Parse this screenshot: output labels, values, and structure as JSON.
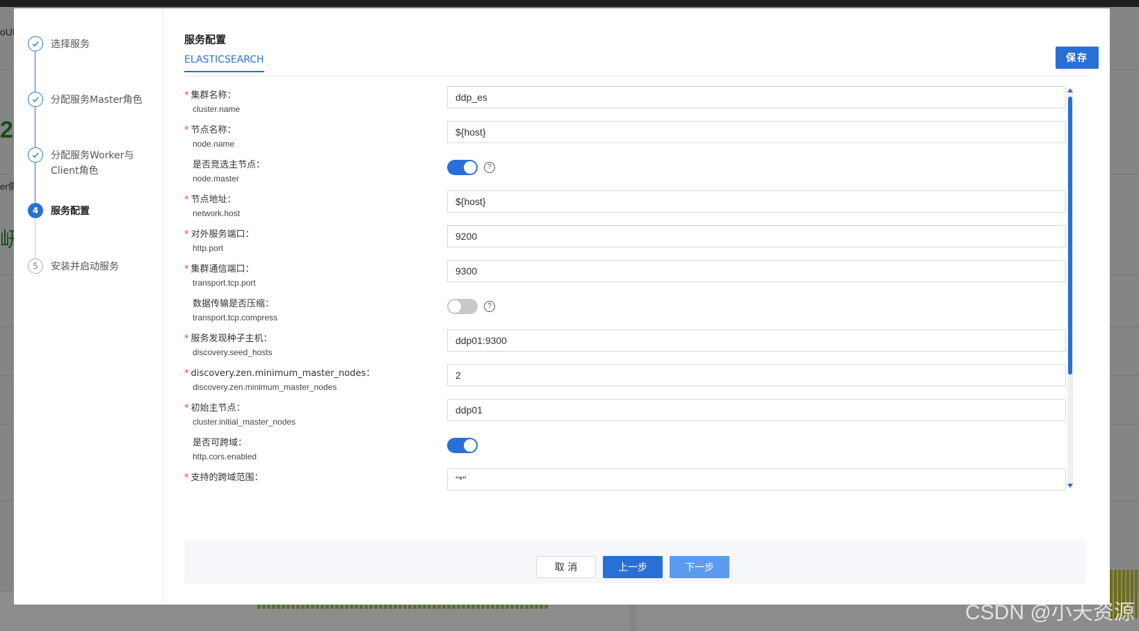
{
  "background": {
    "left_fragments": [
      "oUI",
      "2",
      "er俱",
      "岍"
    ]
  },
  "steps": [
    {
      "label": "选择服务",
      "state": "done"
    },
    {
      "label": "分配服务Master角色",
      "state": "done"
    },
    {
      "label": "分配服务Worker与Client角色",
      "state": "done"
    },
    {
      "label": "服务配置",
      "state": "active",
      "number": "4"
    },
    {
      "label": "安装并启动服务",
      "state": "pending",
      "number": "5"
    }
  ],
  "section": {
    "title": "服务配置",
    "tab": "ELASTICSEARCH",
    "save_label": "保存"
  },
  "form": [
    {
      "label": "集群名称：",
      "key": "cluster.name",
      "required": true,
      "type": "text",
      "value": "ddp_es",
      "help": true
    },
    {
      "label": "节点名称：",
      "key": "node.name",
      "required": true,
      "type": "text",
      "value": "${host}",
      "help": false
    },
    {
      "label": "是否竞选主节点：",
      "key": "node.master",
      "required": false,
      "type": "switch",
      "on": true,
      "help": true
    },
    {
      "label": "节点地址：",
      "key": "network.host",
      "required": true,
      "type": "text",
      "value": "${host}",
      "help": false
    },
    {
      "label": "对外服务端口：",
      "key": "http.port",
      "required": true,
      "type": "text",
      "value": "9200",
      "help": true
    },
    {
      "label": "集群通信端口：",
      "key": "transport.tcp.port",
      "required": true,
      "type": "text",
      "value": "9300",
      "help": false
    },
    {
      "label": "数据传输是否压缩：",
      "key": "transport.tcp.compress",
      "required": false,
      "type": "switch",
      "on": false,
      "help": true
    },
    {
      "label": "服务发现种子主机：",
      "key": "discovery.seed_hosts",
      "required": true,
      "type": "text",
      "value": "ddp01:9300",
      "help": false
    },
    {
      "label": "discovery.zen.minimum_master_nodes：",
      "key": "discovery.zen.minimum_master_nodes",
      "required": true,
      "type": "text",
      "value": "2",
      "help": false
    },
    {
      "label": "初始主节点：",
      "key": "cluster.initial_master_nodes",
      "required": true,
      "type": "text",
      "value": "ddp01",
      "help": false
    },
    {
      "label": "是否可跨域：",
      "key": "http.cors.enabled",
      "required": false,
      "type": "switch",
      "on": true,
      "help": false
    },
    {
      "label": "支持的跨域范围：",
      "key": "",
      "required": true,
      "type": "text",
      "value": "\"*\"",
      "help": false
    }
  ],
  "footer": {
    "cancel_label": "取 消",
    "prev_label": "上一步",
    "next_label": "下一步"
  },
  "watermark": "CSDN @小天资源",
  "colors": {
    "primary": "#2970d6",
    "required": "#e84040",
    "next_button": "#5b9cf0"
  }
}
